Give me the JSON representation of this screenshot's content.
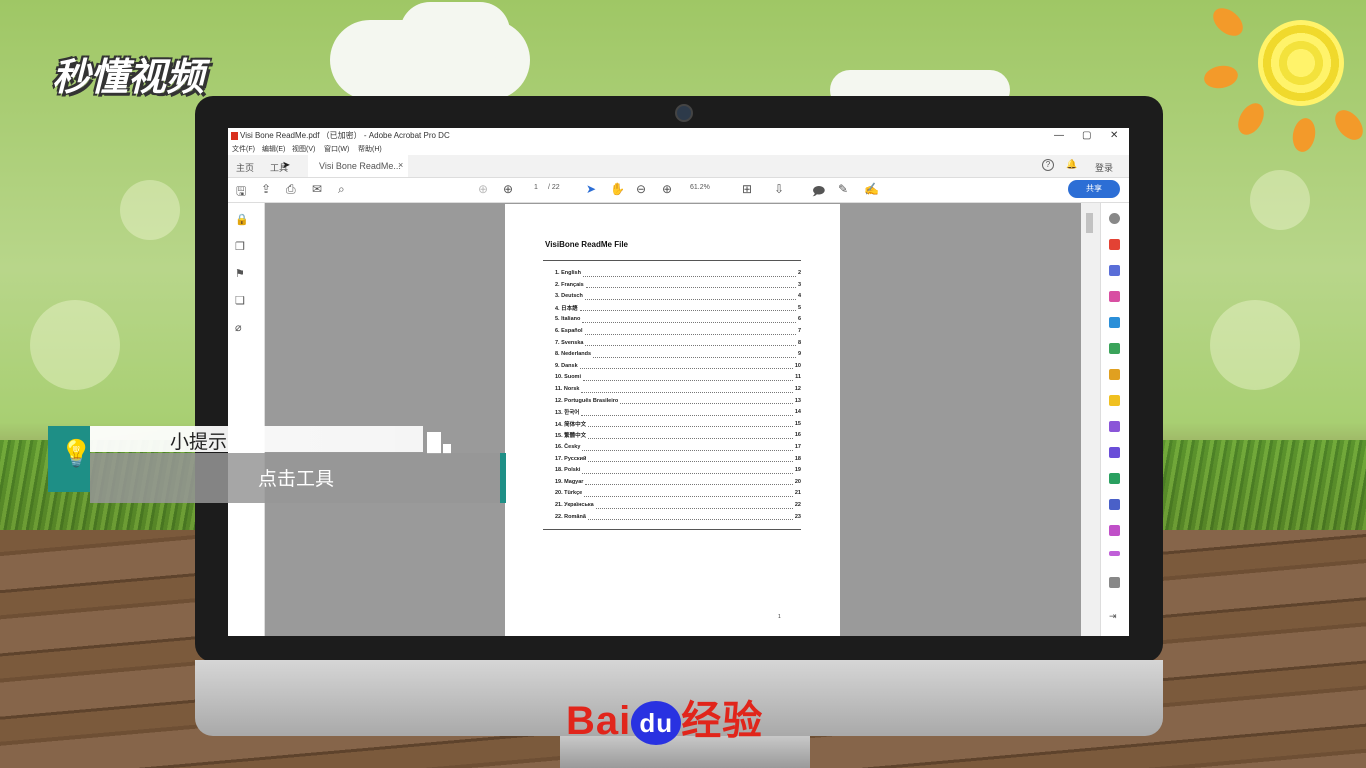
{
  "brand": {
    "logo_text": "秒懂视频",
    "bottom_logo_left": "Bai",
    "bottom_logo_du": "du",
    "bottom_logo_right": "经验"
  },
  "window": {
    "title": "Visi Bone ReadMe.pdf （已加密） - Adobe Acrobat Pro DC",
    "controls": [
      "✕",
      "▢",
      "—"
    ]
  },
  "menu": [
    "文件(F)",
    "编辑(E)",
    "视图(V)",
    "窗口(W)",
    "帮助(H)"
  ],
  "tabs": {
    "home": "主页",
    "tools": "工具",
    "document": "Visi Bone ReadMe...",
    "close": "×",
    "login": "登录",
    "help": "?"
  },
  "toolbar": {
    "page_current": "1",
    "page_total": "/ 22",
    "zoom": "61.2%",
    "share": "共享"
  },
  "document": {
    "title": "VisiBone ReadMe File",
    "page_number": "1",
    "toc": [
      {
        "num": "1.",
        "name": "English",
        "page": "2"
      },
      {
        "num": "2.",
        "name": "Français",
        "page": "3"
      },
      {
        "num": "3.",
        "name": "Deutsch",
        "page": "4"
      },
      {
        "num": "4.",
        "name": "日本語",
        "page": "5"
      },
      {
        "num": "5.",
        "name": "Italiano",
        "page": "6"
      },
      {
        "num": "6.",
        "name": "Español",
        "page": "7"
      },
      {
        "num": "7.",
        "name": "Svenska",
        "page": "8"
      },
      {
        "num": "8.",
        "name": "Nederlands",
        "page": "9"
      },
      {
        "num": "9.",
        "name": "Dansk",
        "page": "10"
      },
      {
        "num": "10.",
        "name": "Suomi",
        "page": "11"
      },
      {
        "num": "11.",
        "name": "Norsk",
        "page": "12"
      },
      {
        "num": "12.",
        "name": "Português Brasileiro",
        "page": "13"
      },
      {
        "num": "13.",
        "name": "한국어",
        "page": "14"
      },
      {
        "num": "14.",
        "name": "简体中文",
        "page": "15"
      },
      {
        "num": "15.",
        "name": "繁體中文",
        "page": "16"
      },
      {
        "num": "16.",
        "name": "Česky",
        "page": "17"
      },
      {
        "num": "17.",
        "name": "Русский",
        "page": "18"
      },
      {
        "num": "18.",
        "name": "Polski",
        "page": "19"
      },
      {
        "num": "19.",
        "name": "Magyar",
        "page": "20"
      },
      {
        "num": "20.",
        "name": "Türkçe",
        "page": "21"
      },
      {
        "num": "21.",
        "name": "Українська",
        "page": "22"
      },
      {
        "num": "22.",
        "name": "Română",
        "page": "23"
      }
    ]
  },
  "tip": {
    "title": "小提示",
    "text": "点击工具"
  },
  "colors": {
    "accent_teal": "#1e8f86",
    "share_blue": "#2c6ed5",
    "baidu_red": "#e1251b",
    "baidu_blue": "#2932e1"
  }
}
